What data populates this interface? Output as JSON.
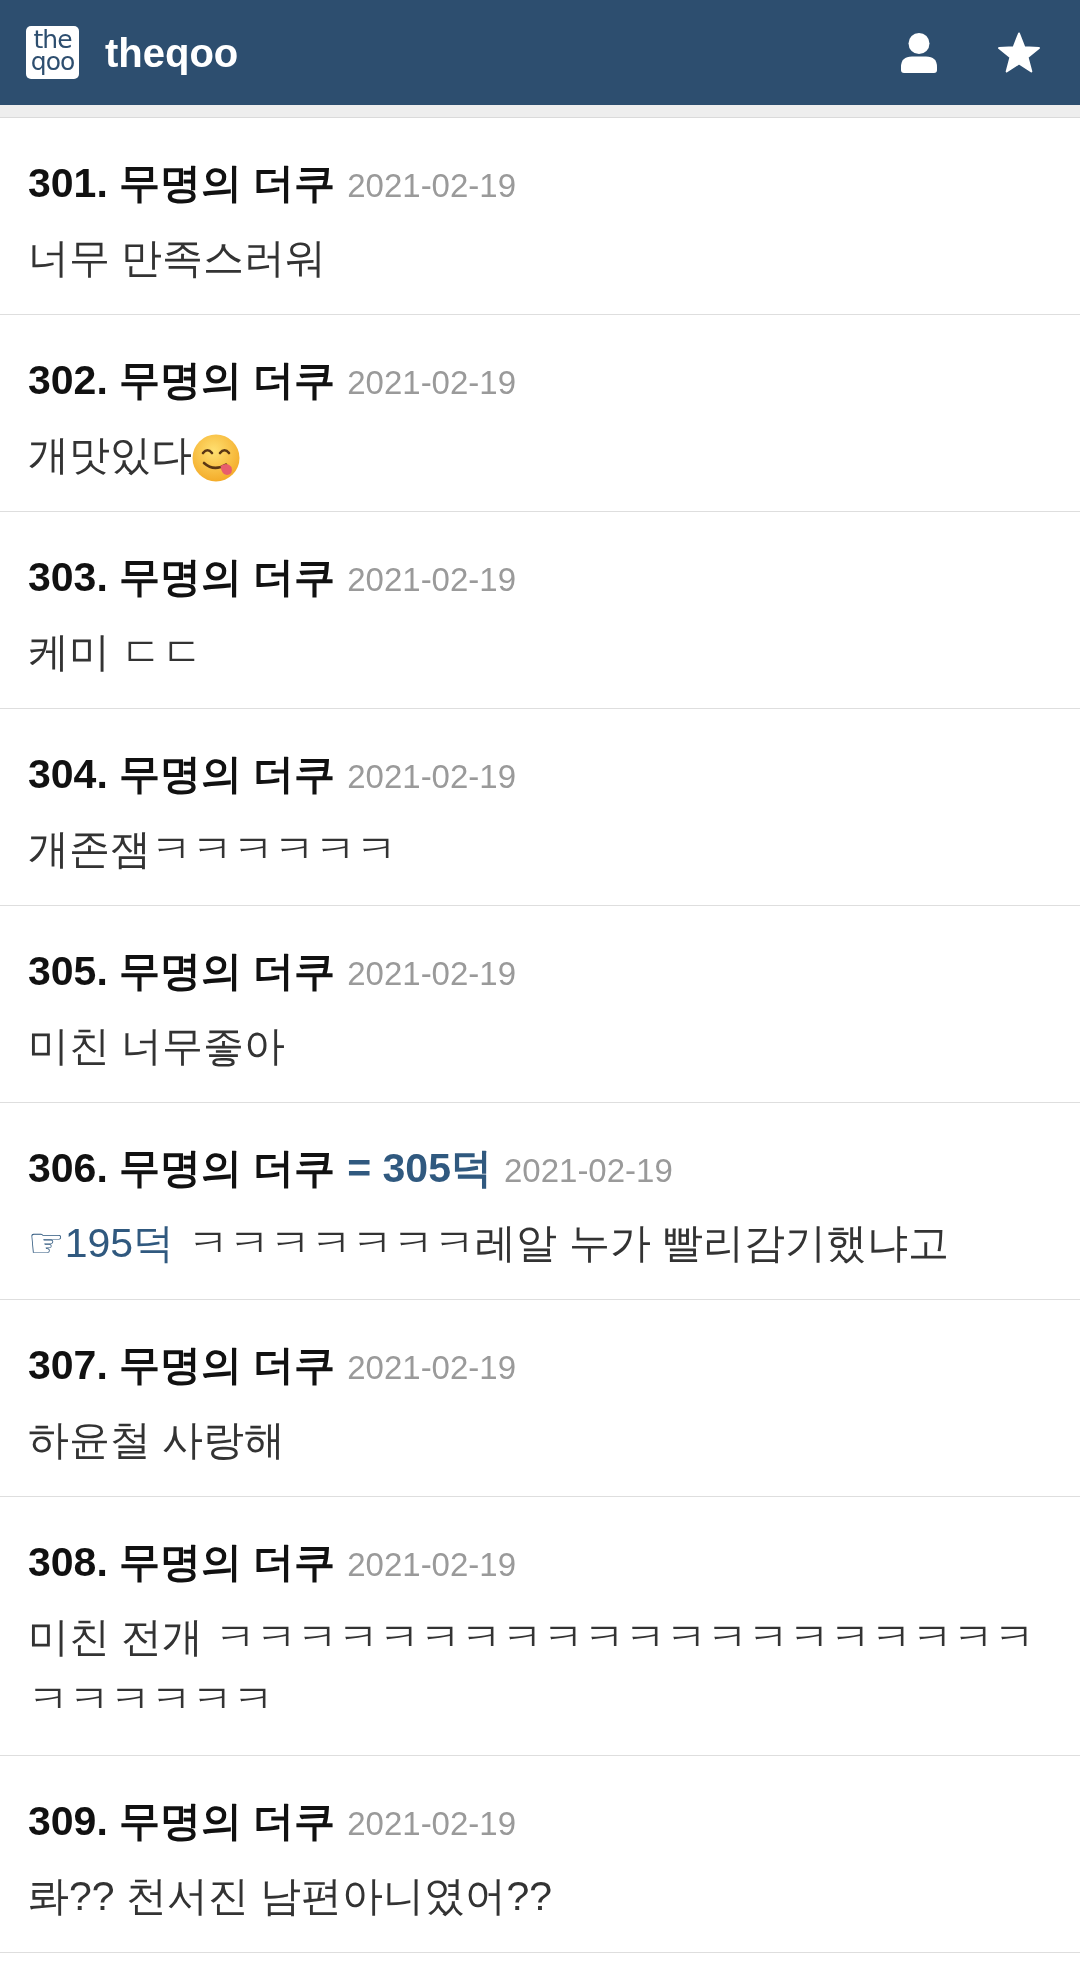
{
  "header": {
    "logo": [
      "the",
      "qoo"
    ],
    "site_name": "theqoo"
  },
  "comments": [
    {
      "number": "301.",
      "author": "무명의 더쿠",
      "date": "2021-02-19",
      "body": "너무 만족스러워"
    },
    {
      "number": "302.",
      "author": "무명의 더쿠",
      "date": "2021-02-19",
      "body": "개맛있다",
      "emoji": true
    },
    {
      "number": "303.",
      "author": "무명의 더쿠",
      "date": "2021-02-19",
      "body": "케미 ㄷㄷ"
    },
    {
      "number": "304.",
      "author": "무명의 더쿠",
      "date": "2021-02-19",
      "body": "개존잼ㅋㅋㅋㅋㅋㅋ"
    },
    {
      "number": "305.",
      "author": "무명의 더쿠",
      "date": "2021-02-19",
      "body": "미친 너무좋아"
    },
    {
      "number": "306.",
      "author": "무명의 더쿠",
      "same_author": "= 305덕",
      "date": "2021-02-19",
      "reply_to": "☞195덕",
      "body": "ㅋㅋㅋㅋㅋㅋㅋ레알 누가 빨리감기했냐고"
    },
    {
      "number": "307.",
      "author": "무명의 더쿠",
      "date": "2021-02-19",
      "body": "하윤철 사랑해"
    },
    {
      "number": "308.",
      "author": "무명의 더쿠",
      "date": "2021-02-19",
      "body": "미친 전개 ㅋㅋㅋㅋㅋㅋㅋㅋㅋㅋㅋㅋㅋㅋㅋㅋㅋㅋㅋㅋㅋㅋㅋㅋㅋㅋ"
    },
    {
      "number": "309.",
      "author": "무명의 더쿠",
      "date": "2021-02-19",
      "body": "롸?? 천서진 남편아니였어??"
    }
  ]
}
